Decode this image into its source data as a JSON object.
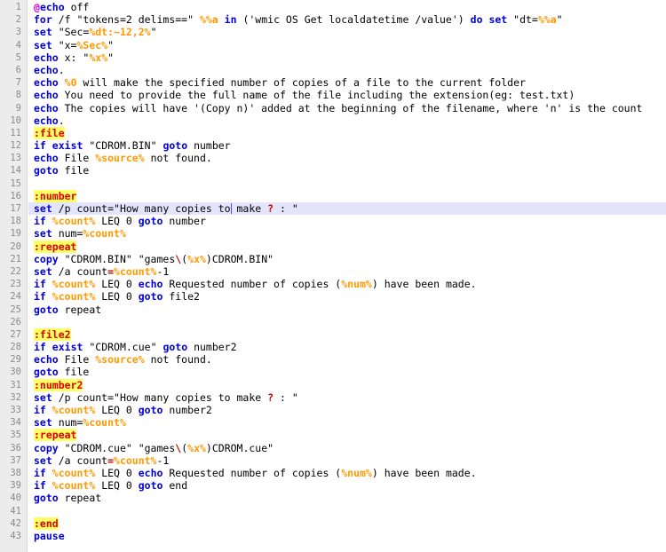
{
  "editor": {
    "title": "batch-script-editor",
    "language": "Batch",
    "gutter_color": "#ececec",
    "active_line_color": "#e4e4fb",
    "label_highlight_color": "#ffff66",
    "keyword_color": "#0000dd",
    "variable_color": "#ff9900",
    "operator_color": "#cc0000",
    "label_color": "#dd0000",
    "active_line_number": 17,
    "total_lines": 43,
    "caret_after_text": "to"
  },
  "lines": [
    {
      "n": "1",
      "tokens": [
        {
          "t": "@",
          "c": "at"
        },
        {
          "t": "echo",
          "c": "kw"
        },
        {
          "t": " off",
          "c": "txt"
        }
      ]
    },
    {
      "n": "2",
      "tokens": [
        {
          "t": "for",
          "c": "kw"
        },
        {
          "t": " /f \"tokens=2 delims==\" ",
          "c": "txt"
        },
        {
          "t": "%%a",
          "c": "var"
        },
        {
          "t": " ",
          "c": "txt"
        },
        {
          "t": "in",
          "c": "kw"
        },
        {
          "t": " ('wmic OS Get localdatetime /value') ",
          "c": "txt"
        },
        {
          "t": "do",
          "c": "kw"
        },
        {
          "t": " ",
          "c": "txt"
        },
        {
          "t": "set",
          "c": "kw"
        },
        {
          "t": " \"dt=",
          "c": "txt"
        },
        {
          "t": "%%a",
          "c": "var"
        },
        {
          "t": "\"",
          "c": "txt"
        }
      ]
    },
    {
      "n": "3",
      "tokens": [
        {
          "t": "set",
          "c": "kw"
        },
        {
          "t": " \"Sec=",
          "c": "txt"
        },
        {
          "t": "%dt:~12,2%",
          "c": "var"
        },
        {
          "t": "\"",
          "c": "txt"
        }
      ]
    },
    {
      "n": "4",
      "tokens": [
        {
          "t": "set",
          "c": "kw"
        },
        {
          "t": " \"x=",
          "c": "txt"
        },
        {
          "t": "%Sec%",
          "c": "var"
        },
        {
          "t": "\"",
          "c": "txt"
        }
      ]
    },
    {
      "n": "5",
      "tokens": [
        {
          "t": "echo",
          "c": "kw"
        },
        {
          "t": " x: \"",
          "c": "txt"
        },
        {
          "t": "%x%",
          "c": "var"
        },
        {
          "t": "\"",
          "c": "txt"
        }
      ]
    },
    {
      "n": "6",
      "tokens": [
        {
          "t": "echo",
          "c": "kw"
        },
        {
          "t": ".",
          "c": "txt"
        }
      ]
    },
    {
      "n": "7",
      "tokens": [
        {
          "t": "echo",
          "c": "kw"
        },
        {
          "t": " ",
          "c": "txt"
        },
        {
          "t": "%0",
          "c": "var"
        },
        {
          "t": " will make the specified number of copies of a file to the current folder",
          "c": "txt"
        }
      ]
    },
    {
      "n": "8",
      "tokens": [
        {
          "t": "echo",
          "c": "kw"
        },
        {
          "t": " You need to provide the full name of the file including the extension(eg: test.txt)",
          "c": "txt"
        }
      ]
    },
    {
      "n": "9",
      "tokens": [
        {
          "t": "echo",
          "c": "kw"
        },
        {
          "t": " The copies will have '(Copy n)' added at the beginning of the filename, where 'n' is the count",
          "c": "txt"
        }
      ]
    },
    {
      "n": "10",
      "tokens": [
        {
          "t": "echo",
          "c": "kw"
        },
        {
          "t": ".",
          "c": "txt"
        }
      ]
    },
    {
      "n": "11",
      "tokens": [
        {
          "t": ":file",
          "c": "lbl"
        }
      ]
    },
    {
      "n": "12",
      "tokens": [
        {
          "t": "if",
          "c": "kw"
        },
        {
          "t": " ",
          "c": "txt"
        },
        {
          "t": "exist",
          "c": "kw"
        },
        {
          "t": " \"CDROM.BIN\" ",
          "c": "txt"
        },
        {
          "t": "goto",
          "c": "kw"
        },
        {
          "t": " number",
          "c": "txt"
        }
      ]
    },
    {
      "n": "13",
      "tokens": [
        {
          "t": "echo",
          "c": "kw"
        },
        {
          "t": " File ",
          "c": "txt"
        },
        {
          "t": "%source%",
          "c": "var"
        },
        {
          "t": " not found.",
          "c": "txt"
        }
      ]
    },
    {
      "n": "14",
      "tokens": [
        {
          "t": "goto",
          "c": "kw"
        },
        {
          "t": " file",
          "c": "txt"
        }
      ]
    },
    {
      "n": "15",
      "tokens": []
    },
    {
      "n": "16",
      "tokens": [
        {
          "t": ":number",
          "c": "lbl"
        }
      ]
    },
    {
      "n": "17",
      "active": true,
      "tokens": [
        {
          "t": "set",
          "c": "kw"
        },
        {
          "t": " /p count=\"How many copies to",
          "c": "txt"
        },
        {
          "t": "|CARET|",
          "c": "caret"
        },
        {
          "t": " make ",
          "c": "txt"
        },
        {
          "t": "?",
          "c": "op"
        },
        {
          "t": " : \"",
          "c": "txt"
        }
      ]
    },
    {
      "n": "18",
      "tokens": [
        {
          "t": "if",
          "c": "kw"
        },
        {
          "t": " ",
          "c": "txt"
        },
        {
          "t": "%count%",
          "c": "var"
        },
        {
          "t": " LEQ 0 ",
          "c": "txt"
        },
        {
          "t": "goto",
          "c": "kw"
        },
        {
          "t": " number",
          "c": "txt"
        }
      ]
    },
    {
      "n": "19",
      "tokens": [
        {
          "t": "set",
          "c": "kw"
        },
        {
          "t": " num=",
          "c": "txt"
        },
        {
          "t": "%count%",
          "c": "var"
        }
      ]
    },
    {
      "n": "20",
      "tokens": [
        {
          "t": ":repeat",
          "c": "lbl"
        }
      ]
    },
    {
      "n": "21",
      "tokens": [
        {
          "t": "copy",
          "c": "kw"
        },
        {
          "t": " \"CDROM.BIN\" \"games",
          "c": "txt"
        },
        {
          "t": "\\",
          "c": "op"
        },
        {
          "t": "(",
          "c": "txt"
        },
        {
          "t": "%x%",
          "c": "var"
        },
        {
          "t": ")CDROM.BIN\"",
          "c": "txt"
        }
      ]
    },
    {
      "n": "22",
      "tokens": [
        {
          "t": "set",
          "c": "kw"
        },
        {
          "t": " /a count",
          "c": "txt"
        },
        {
          "t": "=",
          "c": "op"
        },
        {
          "t": "%count%",
          "c": "var"
        },
        {
          "t": "-1",
          "c": "txt"
        }
      ]
    },
    {
      "n": "23",
      "tokens": [
        {
          "t": "if",
          "c": "kw"
        },
        {
          "t": " ",
          "c": "txt"
        },
        {
          "t": "%count%",
          "c": "var"
        },
        {
          "t": " LEQ 0 ",
          "c": "txt"
        },
        {
          "t": "echo",
          "c": "kw"
        },
        {
          "t": " Requested number of copies (",
          "c": "txt"
        },
        {
          "t": "%num%",
          "c": "var"
        },
        {
          "t": ") have been made.",
          "c": "txt"
        }
      ]
    },
    {
      "n": "24",
      "tokens": [
        {
          "t": "if",
          "c": "kw"
        },
        {
          "t": " ",
          "c": "txt"
        },
        {
          "t": "%count%",
          "c": "var"
        },
        {
          "t": " LEQ 0 ",
          "c": "txt"
        },
        {
          "t": "goto",
          "c": "kw"
        },
        {
          "t": " file2",
          "c": "txt"
        }
      ]
    },
    {
      "n": "25",
      "tokens": [
        {
          "t": "goto",
          "c": "kw"
        },
        {
          "t": " repeat",
          "c": "txt"
        }
      ]
    },
    {
      "n": "26",
      "tokens": []
    },
    {
      "n": "27",
      "tokens": [
        {
          "t": ":file2",
          "c": "lbl"
        }
      ]
    },
    {
      "n": "28",
      "tokens": [
        {
          "t": "if",
          "c": "kw"
        },
        {
          "t": " ",
          "c": "txt"
        },
        {
          "t": "exist",
          "c": "kw"
        },
        {
          "t": " \"CDROM.cue\" ",
          "c": "txt"
        },
        {
          "t": "goto",
          "c": "kw"
        },
        {
          "t": " number2",
          "c": "txt"
        }
      ]
    },
    {
      "n": "29",
      "tokens": [
        {
          "t": "echo",
          "c": "kw"
        },
        {
          "t": " File ",
          "c": "txt"
        },
        {
          "t": "%source%",
          "c": "var"
        },
        {
          "t": " not found.",
          "c": "txt"
        }
      ]
    },
    {
      "n": "30",
      "tokens": [
        {
          "t": "goto",
          "c": "kw"
        },
        {
          "t": " file",
          "c": "txt"
        }
      ]
    },
    {
      "n": "31",
      "tokens": [
        {
          "t": ":number2",
          "c": "lbl"
        }
      ]
    },
    {
      "n": "32",
      "tokens": [
        {
          "t": "set",
          "c": "kw"
        },
        {
          "t": " /p count=\"How many copies to make ",
          "c": "txt"
        },
        {
          "t": "?",
          "c": "op"
        },
        {
          "t": " : \"",
          "c": "txt"
        }
      ]
    },
    {
      "n": "33",
      "tokens": [
        {
          "t": "if",
          "c": "kw"
        },
        {
          "t": " ",
          "c": "txt"
        },
        {
          "t": "%count%",
          "c": "var"
        },
        {
          "t": " LEQ 0 ",
          "c": "txt"
        },
        {
          "t": "goto",
          "c": "kw"
        },
        {
          "t": " number2",
          "c": "txt"
        }
      ]
    },
    {
      "n": "34",
      "tokens": [
        {
          "t": "set",
          "c": "kw"
        },
        {
          "t": " num=",
          "c": "txt"
        },
        {
          "t": "%count%",
          "c": "var"
        }
      ]
    },
    {
      "n": "35",
      "tokens": [
        {
          "t": ":repeat",
          "c": "lbl"
        }
      ]
    },
    {
      "n": "36",
      "tokens": [
        {
          "t": "copy",
          "c": "kw"
        },
        {
          "t": " \"CDROM.cue\" \"games",
          "c": "txt"
        },
        {
          "t": "\\",
          "c": "op"
        },
        {
          "t": "(",
          "c": "txt"
        },
        {
          "t": "%x%",
          "c": "var"
        },
        {
          "t": ")CDROM.cue\"",
          "c": "txt"
        }
      ]
    },
    {
      "n": "37",
      "tokens": [
        {
          "t": "set",
          "c": "kw"
        },
        {
          "t": " /a count",
          "c": "txt"
        },
        {
          "t": "=",
          "c": "op"
        },
        {
          "t": "%count%",
          "c": "var"
        },
        {
          "t": "-1",
          "c": "txt"
        }
      ]
    },
    {
      "n": "38",
      "tokens": [
        {
          "t": "if",
          "c": "kw"
        },
        {
          "t": " ",
          "c": "txt"
        },
        {
          "t": "%count%",
          "c": "var"
        },
        {
          "t": " LEQ 0 ",
          "c": "txt"
        },
        {
          "t": "echo",
          "c": "kw"
        },
        {
          "t": " Requested number of copies (",
          "c": "txt"
        },
        {
          "t": "%num%",
          "c": "var"
        },
        {
          "t": ") have been made.",
          "c": "txt"
        }
      ]
    },
    {
      "n": "39",
      "tokens": [
        {
          "t": "if",
          "c": "kw"
        },
        {
          "t": " ",
          "c": "txt"
        },
        {
          "t": "%count%",
          "c": "var"
        },
        {
          "t": " LEQ 0 ",
          "c": "txt"
        },
        {
          "t": "goto",
          "c": "kw"
        },
        {
          "t": " end",
          "c": "txt"
        }
      ]
    },
    {
      "n": "40",
      "tokens": [
        {
          "t": "goto",
          "c": "kw"
        },
        {
          "t": " repeat",
          "c": "txt"
        }
      ]
    },
    {
      "n": "41",
      "tokens": []
    },
    {
      "n": "42",
      "tokens": [
        {
          "t": ":end",
          "c": "lbl"
        }
      ]
    },
    {
      "n": "43",
      "tokens": [
        {
          "t": "pause",
          "c": "kw"
        }
      ]
    }
  ]
}
